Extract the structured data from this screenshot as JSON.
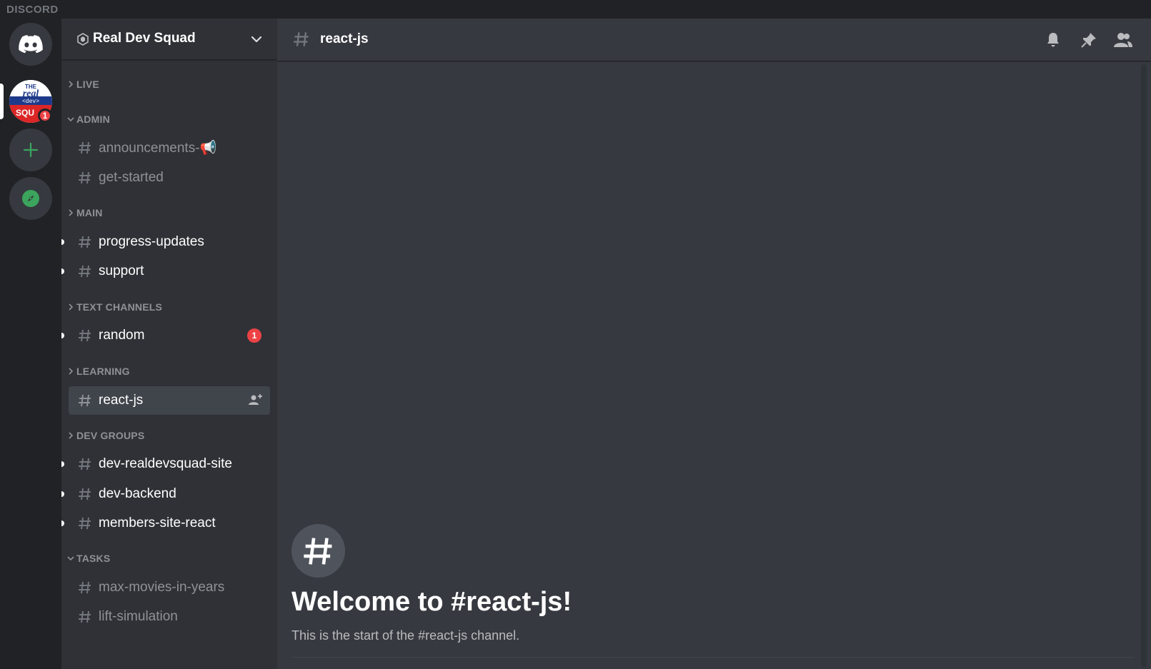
{
  "app": {
    "brand": "DISCORD"
  },
  "guilds": {
    "server_badge": "1"
  },
  "server": {
    "name": "Real Dev Squad"
  },
  "sidebar": {
    "categories": [
      {
        "label": "LIVE",
        "collapsed": true
      },
      {
        "label": "ADMIN",
        "collapsed": false
      },
      {
        "label": "MAIN",
        "collapsed": true
      },
      {
        "label": "TEXT CHANNELS",
        "collapsed": true
      },
      {
        "label": "LEARNING",
        "collapsed": true
      },
      {
        "label": "DEV GROUPS",
        "collapsed": true
      },
      {
        "label": "TASKS",
        "collapsed": false
      }
    ],
    "channels": [
      {
        "label": "announcements-📢",
        "category": "ADMIN",
        "unread": false
      },
      {
        "label": "get-started",
        "category": "ADMIN",
        "unread": false
      },
      {
        "label": "progress-updates",
        "category": "MAIN",
        "unread": true
      },
      {
        "label": "support",
        "category": "MAIN",
        "unread": true
      },
      {
        "label": "random",
        "category": "TEXT CHANNELS",
        "unread": true,
        "mentions": "1"
      },
      {
        "label": "react-js",
        "category": "LEARNING",
        "active": true
      },
      {
        "label": "dev-realdevsquad-site",
        "category": "DEV GROUPS",
        "unread": true
      },
      {
        "label": "dev-backend",
        "category": "DEV GROUPS",
        "unread": true
      },
      {
        "label": "members-site-react",
        "category": "DEV GROUPS",
        "unread": true
      },
      {
        "label": "max-movies-in-years",
        "category": "TASKS",
        "unread": false
      },
      {
        "label": "lift-simulation",
        "category": "TASKS",
        "unread": false
      }
    ]
  },
  "main": {
    "channel_name": "react-js",
    "welcome_title": "Welcome to #react-js!",
    "welcome_subtitle": "This is the start of the #react-js channel."
  },
  "colors": {
    "accent_green": "#3ba55d",
    "mention_red": "#ed4245",
    "bg_main": "#36393f",
    "bg_sidebar": "#2f3136",
    "bg_guilds": "#202225"
  },
  "icons": [
    "discord-logo-icon",
    "server-shield-icon",
    "chevron-down-icon",
    "hash-icon",
    "bell-icon",
    "pin-icon",
    "members-icon",
    "add-member-icon",
    "plus-icon",
    "compass-icon"
  ]
}
